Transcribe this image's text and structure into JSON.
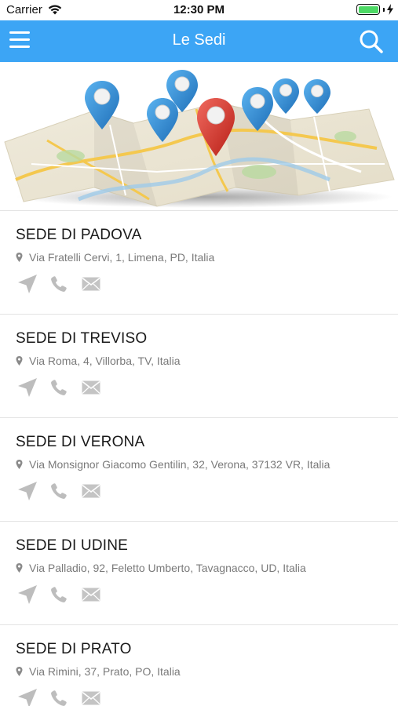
{
  "status_bar": {
    "carrier": "Carrier",
    "time": "12:30 PM"
  },
  "nav": {
    "title": "Le Sedi"
  },
  "locations": [
    {
      "name": "SEDE DI PADOVA",
      "address": "Via Fratelli Cervi, 1, Limena, PD, Italia"
    },
    {
      "name": "SEDE DI TREVISO",
      "address": "Via Roma, 4, Villorba, TV, Italia"
    },
    {
      "name": "SEDE DI VERONA",
      "address": "Via Monsignor Giacomo Gentilin, 32, Verona, 37132 VR, Italia"
    },
    {
      "name": "SEDE DI UDINE",
      "address": "Via Palladio, 92, Feletto Umberto, Tavagnacco, UD, Italia"
    },
    {
      "name": "SEDE DI PRATO",
      "address": "Via Rimini, 37, Prato, PO, Italia"
    }
  ],
  "colors": {
    "nav_bar": "#3ca5f5",
    "icon_gray": "#bdbdbd",
    "pin_blue": "#2f8fd8",
    "pin_red": "#e03a2f",
    "battery": "#4cd964"
  },
  "icons": {
    "menu": "hamburger-menu-icon",
    "search": "search-icon",
    "address": "location-pin-icon",
    "navigate": "navigation-arrow-icon",
    "call": "phone-icon",
    "email": "mail-icon"
  }
}
